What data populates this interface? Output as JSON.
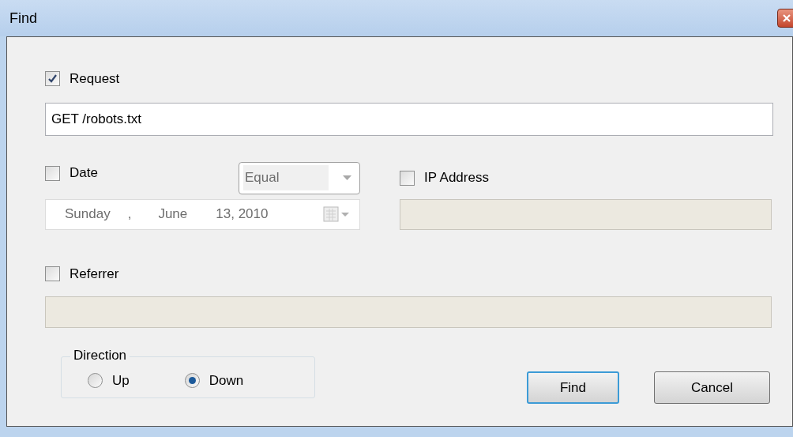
{
  "window": {
    "title": "Find"
  },
  "request": {
    "label": "Request",
    "checked": true,
    "value": "GET /robots.txt"
  },
  "date": {
    "label": "Date",
    "checked": false,
    "operator": "Equal",
    "weekday": "Sunday",
    "separator": ",",
    "month": "June",
    "day_year": "13, 2010"
  },
  "ip_address": {
    "label": "IP Address",
    "checked": false
  },
  "referrer": {
    "label": "Referrer",
    "checked": false
  },
  "direction": {
    "title": "Direction",
    "options": [
      {
        "label": "Up",
        "selected": false
      },
      {
        "label": "Down",
        "selected": true
      }
    ]
  },
  "buttons": [
    {
      "label": "Find",
      "kind": "default"
    },
    {
      "label": "Cancel",
      "kind": "normal"
    }
  ]
}
